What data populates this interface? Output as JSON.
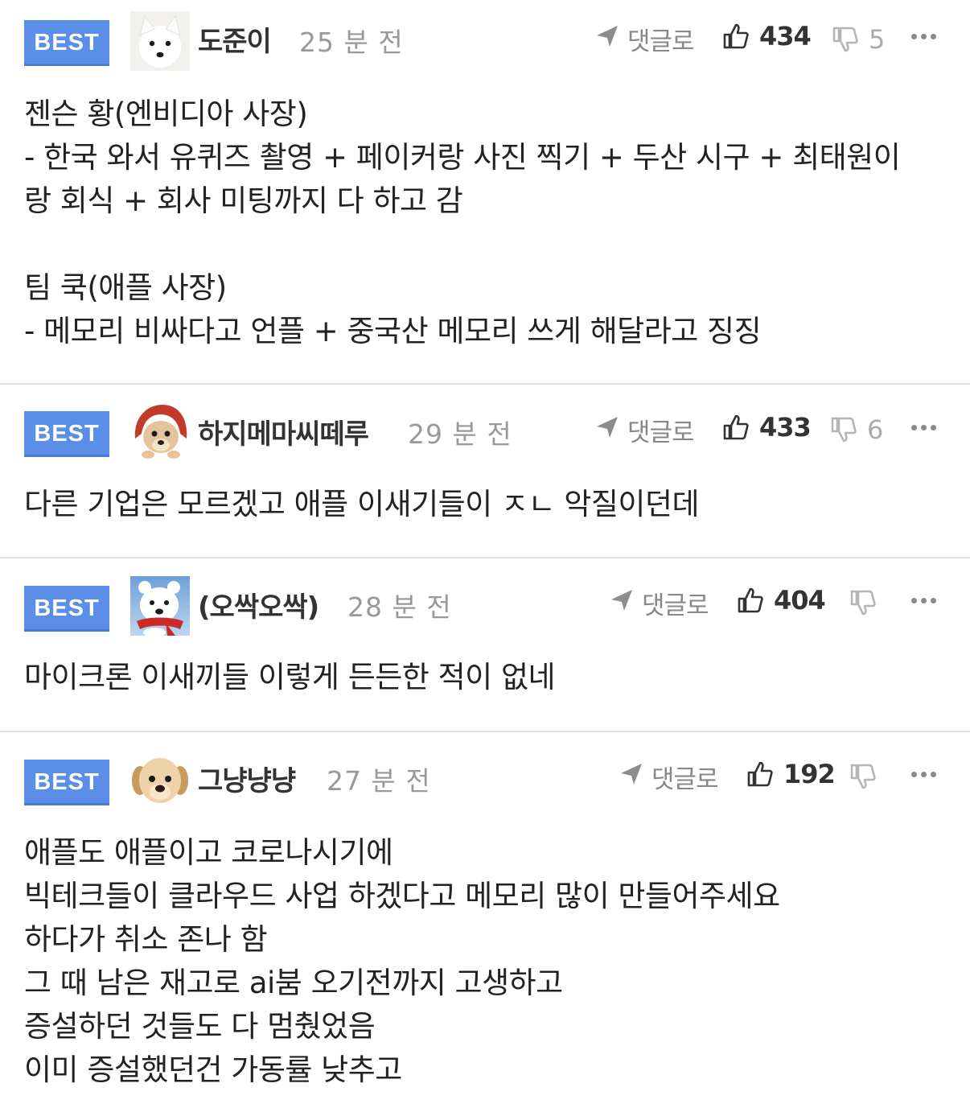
{
  "colors": {
    "best_badge": "#5b8ee6",
    "divider": "#dcdcdc",
    "meta_gray": "#999999",
    "text": "#222222"
  },
  "comments": [
    {
      "badge": "BEST",
      "avatar_icon": "white-dog-avatar-icon",
      "nickname": "도준이",
      "time": "25 분 전",
      "reply_label": "댓글로",
      "likes": "434",
      "dislikes": "5",
      "lines": [
        "젠슨 황(엔비디아 사장)",
        "- 한국 와서 유퀴즈 촬영 + 페이커랑 사진 찍기 + 두산 시구 + 최태원이",
        "랑 회식 + 회사 미팅까지 다 하고 감",
        "",
        "팀 쿡(애플 사장)",
        "- 메모리 비싸다고 언플 + 중국산 메모리 쓰게 해달라고 징징"
      ]
    },
    {
      "badge": "BEST",
      "avatar_icon": "puppy-red-hood-avatar-icon",
      "nickname": "하지메마씨떼루",
      "time": "29 분 전",
      "reply_label": "댓글로",
      "likes": "433",
      "dislikes": "6",
      "lines": [
        "다른 기업은 모르겠고 애플 이새기들이 ㅈㄴ 악질이던데"
      ]
    },
    {
      "badge": "BEST",
      "avatar_icon": "polar-bear-avatar-icon",
      "nickname": "(오싹오싹)",
      "time": "28 분 전",
      "reply_label": "댓글로",
      "likes": "404",
      "dislikes": "",
      "lines": [
        "마이크론 이새끼들 이렇게 든든한 적이 없네"
      ]
    },
    {
      "badge": "BEST",
      "avatar_icon": "golden-puppy-avatar-icon",
      "nickname": "그냥냥냥",
      "time": "27 분 전",
      "reply_label": "댓글로",
      "likes": "192",
      "dislikes": "",
      "lines": [
        "애플도 애플이고 코로나시기에",
        "빅테크들이 클라우드 사업 하겠다고 메모리 많이 만들어주세요",
        "하다가 취소 존나 함",
        "그 때 남은 재고로 ai붐 오기전까지 고생하고",
        "증설하던 것들도 다 멈췄었음",
        "이미 증설했던건 가동률 낮추고"
      ]
    }
  ]
}
